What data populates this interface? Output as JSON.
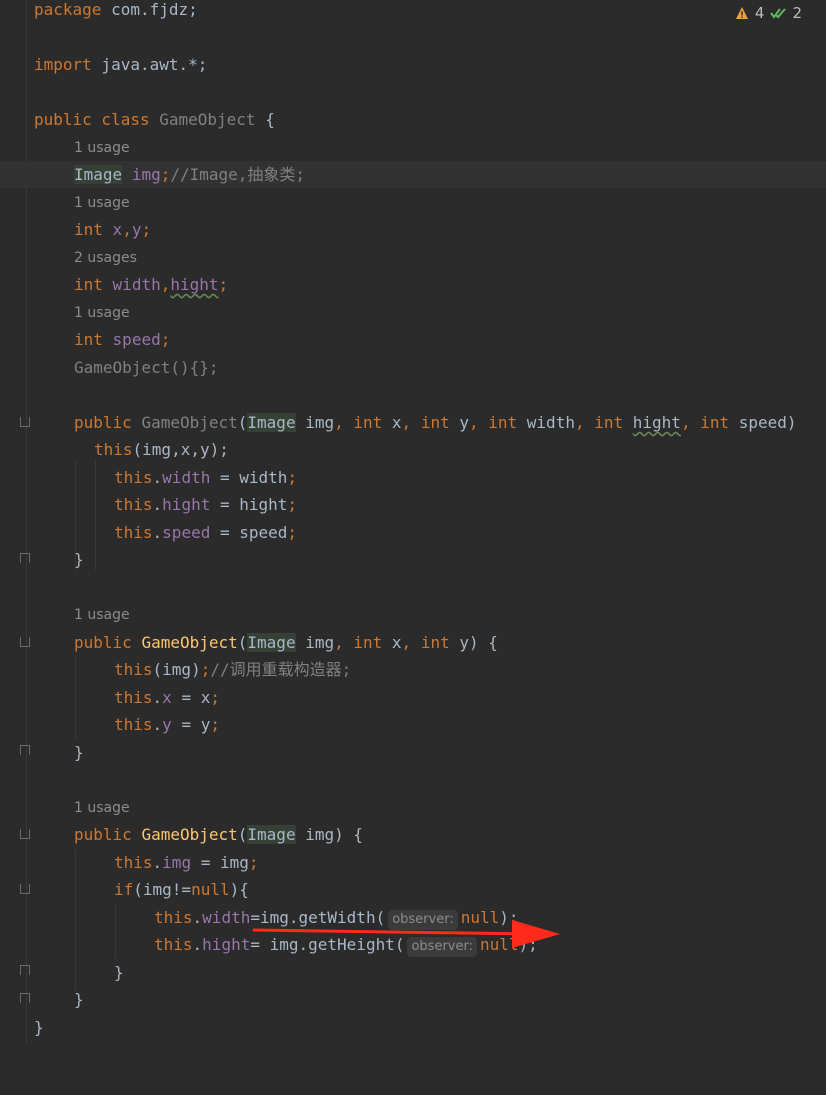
{
  "status": {
    "warnings_count": "4",
    "checks_count": "2"
  },
  "code": {
    "l1_kw": "package",
    "l1_rest": " com.fjdz;",
    "l2_kw": "import",
    "l2_rest": " java.awt.*;",
    "l3_kw": "public class",
    "l3_name": "GameObject",
    "l3_brace": " {",
    "hint_1": "1 usage",
    "l4_type": "Image",
    "l4_field": "img",
    "l4_semi": ";",
    "l4_cmt": "//Image,抽象类;",
    "hint_2": "1 usage",
    "l5_kw": "int",
    "l5_x": "x",
    "l5_comma": ",",
    "l5_y": "y",
    "l5_semi": ";",
    "hint_3": "2 usages",
    "l6_kw": "int",
    "l6_w": "width",
    "l6_comma": ",",
    "l6_h": "hight",
    "l6_semi": ";",
    "hint_4": "1 usage",
    "l7_kw": "int",
    "l7_s": "speed",
    "l7_semi": ";",
    "l8_ctor": "GameObject(){};",
    "l9_kw": "public",
    "l9_name": "GameObject",
    "l9_p1": "(",
    "l9_img_t": "Image",
    "l9_img": " img",
    "l9_c1": ", ",
    "l9_int1": "int",
    "l9_x": " x",
    "l9_c2": ", ",
    "l9_int2": "int",
    "l9_y": " y",
    "l9_c3": ", ",
    "l9_int3": "int",
    "l9_w": " width",
    "l9_c4": ", ",
    "l9_int4": "int",
    "l9_h": "hight",
    "l9_c5": ", ",
    "l9_int5": "int",
    "l9_s": " speed)",
    "l10_this": "this",
    "l10_rest": "(img,x,y);",
    "l11_this": "this",
    "l11_dot": ".",
    "l11_f": "width",
    "l11_rest": " = width",
    "l11_semi": ";",
    "l12_this": "this",
    "l12_dot": ".",
    "l12_f": "hight",
    "l12_rest": " = hight",
    "l12_semi": ";",
    "l13_this": "this",
    "l13_dot": ".",
    "l13_f": "speed",
    "l13_rest": " = speed",
    "l13_semi": ";",
    "l14": "}",
    "hint_5": "1 usage",
    "l15_kw": "public",
    "l15_name": "GameObject",
    "l15_p": "(",
    "l15_t": "Image",
    "l15_img": " img",
    "l15_c1": ", ",
    "l15_int1": "int",
    "l15_x": " x",
    "l15_c2": ", ",
    "l15_int2": "int",
    "l15_y": " y) {",
    "l16_this": "this",
    "l16_rest": "(img)",
    "l16_semi": ";",
    "l16_cmt": "//调用重载构造器;",
    "l17_this": "this",
    "l17_dot": ".",
    "l17_f": "x",
    "l17_rest": " = x",
    "l17_semi": ";",
    "l18_this": "this",
    "l18_dot": ".",
    "l18_f": "y",
    "l18_rest": " = y",
    "l18_semi": ";",
    "l19": "}",
    "hint_6": "1 usage",
    "l20_kw": "public",
    "l20_name": "GameObject",
    "l20_p": "(",
    "l20_t": "Image",
    "l20_rest": " img) {",
    "l21_this": "this",
    "l21_dot": ".",
    "l21_f": "img",
    "l21_rest": " = img",
    "l21_semi": ";",
    "l22_kw": "if",
    "l22_a": "(img!=",
    "l22_null": "null",
    "l22_b": "){",
    "l23_this": "this",
    "l23_dot": ".",
    "l23_f": "width",
    "l23_a": "=img.getWidth(",
    "l23_hint": "observer:",
    "l23_null": "null",
    "l23_b": ");",
    "l24_this": "this",
    "l24_dot": ".",
    "l24_f": "hight",
    "l24_a": "= img.getHeight(",
    "l24_hint": "observer:",
    "l24_null": "null",
    "l24_b": ");",
    "l25": "}",
    "l26": "}",
    "l27": "}"
  }
}
